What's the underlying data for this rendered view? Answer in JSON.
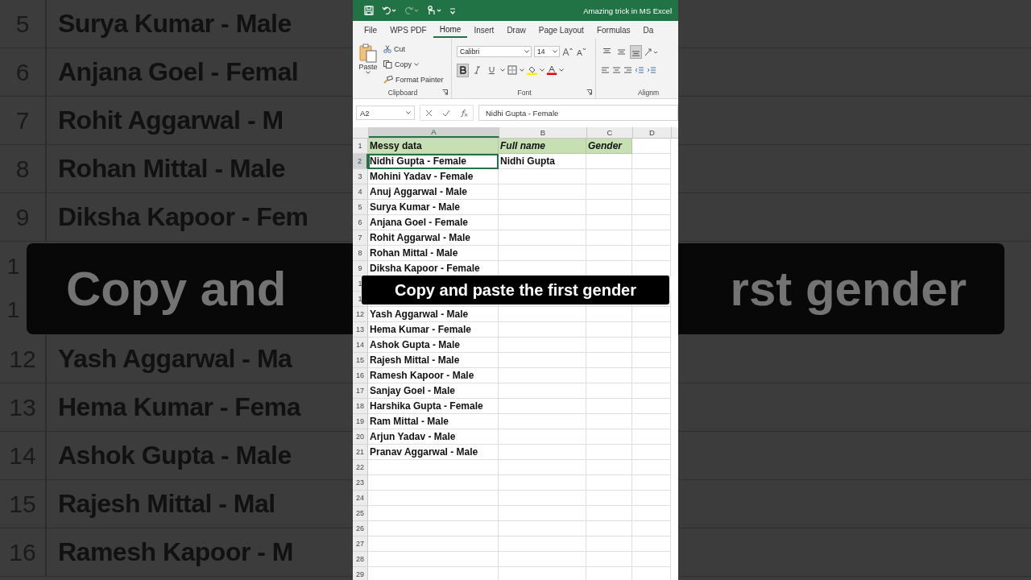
{
  "backdrop": {
    "rows_top": [
      {
        "number": "5",
        "text": "Surya Kumar - Male"
      },
      {
        "number": "6",
        "text": "Anjana Goel - Femal"
      },
      {
        "number": "7",
        "text": "Rohit Aggarwal - M"
      },
      {
        "number": "8",
        "text": "Rohan Mittal - Male"
      },
      {
        "number": "9",
        "text": "Diksha Kapoor - Fem"
      }
    ],
    "numbers_beside_caption": [
      "1",
      "1"
    ],
    "caption_left": "Copy and",
    "caption_right": "rst gender",
    "rows_bottom": [
      {
        "number": "12",
        "text": "Yash Aggarwal - Ma"
      },
      {
        "number": "13",
        "text": "Hema Kumar - Fema"
      },
      {
        "number": "14",
        "text": "Ashok Gupta - Male"
      },
      {
        "number": "15",
        "text": "Rajesh Mittal - Mal"
      },
      {
        "number": "16",
        "text": "Ramesh Kapoor - M"
      }
    ]
  },
  "window": {
    "title": "Amazing trick in MS Excel"
  },
  "tabs": [
    {
      "label": "File",
      "selected": false
    },
    {
      "label": "WPS PDF",
      "selected": false
    },
    {
      "label": "Home",
      "selected": true
    },
    {
      "label": "Insert",
      "selected": false
    },
    {
      "label": "Draw",
      "selected": false
    },
    {
      "label": "Page Layout",
      "selected": false
    },
    {
      "label": "Formulas",
      "selected": false
    },
    {
      "label": "Da",
      "selected": false
    }
  ],
  "clipboard": {
    "paste": "Paste",
    "cut": "Cut",
    "copy": "Copy",
    "format_painter": "Format Painter",
    "label": "Clipboard"
  },
  "font": {
    "name": "Calibri",
    "size": "14",
    "bold": true,
    "italic": false,
    "underline": false,
    "label": "Font"
  },
  "alignment": {
    "label": "Alignm",
    "vertical": [
      {
        "kind": "top",
        "selected": false
      },
      {
        "kind": "middle",
        "selected": false
      },
      {
        "kind": "bottom",
        "selected": true
      }
    ]
  },
  "formula_bar": {
    "name_box": "A2",
    "value": "Nidhi Gupta - Female"
  },
  "columns": [
    {
      "label": "A",
      "selected": true
    },
    {
      "label": "B",
      "selected": false
    },
    {
      "label": "C",
      "selected": false
    },
    {
      "label": "D",
      "selected": false
    }
  ],
  "rows": [
    {
      "kind": "data",
      "number": "1",
      "selected": false,
      "cells": [
        {
          "text": "Messy data",
          "highlighted": true,
          "italic": false
        },
        {
          "text": "Full name",
          "highlighted": true,
          "italic": true
        },
        {
          "text": "Gender",
          "highlighted": true,
          "italic": true
        }
      ]
    },
    {
      "kind": "data",
      "number": "2",
      "selected": true,
      "cells": [
        {
          "text": "Nidhi Gupta - Female",
          "selected": true
        },
        {
          "text": "Nidhi Gupta"
        }
      ]
    },
    {
      "kind": "data",
      "number": "3",
      "selected": false,
      "cells": [
        {
          "text": "Mohini Yadav - Female"
        }
      ]
    },
    {
      "kind": "data",
      "number": "4",
      "selected": false,
      "cells": [
        {
          "text": "Anuj Aggarwal - Male"
        }
      ]
    },
    {
      "kind": "data",
      "number": "5",
      "selected": false,
      "cells": [
        {
          "text": "Surya Kumar - Male"
        }
      ]
    },
    {
      "kind": "data",
      "number": "6",
      "selected": false,
      "cells": [
        {
          "text": "Anjana Goel - Female"
        }
      ]
    },
    {
      "kind": "data",
      "number": "7",
      "selected": false,
      "cells": [
        {
          "text": "Rohit Aggarwal - Male"
        }
      ]
    },
    {
      "kind": "data",
      "number": "8",
      "selected": false,
      "cells": [
        {
          "text": "Rohan Mittal - Male"
        }
      ]
    },
    {
      "kind": "data",
      "number": "9",
      "selected": false,
      "cells": [
        {
          "text": "Diksha Kapoor - Female"
        }
      ]
    },
    {
      "kind": "covered",
      "number": "1",
      "selected": false,
      "cells": []
    },
    {
      "kind": "data",
      "number": "1",
      "selected": false,
      "cells": []
    },
    {
      "kind": "data",
      "number": "12",
      "selected": false,
      "cells": [
        {
          "text": "Yash Aggarwal - Male"
        }
      ]
    },
    {
      "kind": "data",
      "number": "13",
      "selected": false,
      "cells": [
        {
          "text": "Hema Kumar - Female"
        }
      ]
    },
    {
      "kind": "data",
      "number": "14",
      "selected": false,
      "cells": [
        {
          "text": "Ashok Gupta - Male"
        }
      ]
    },
    {
      "kind": "data",
      "number": "15",
      "selected": false,
      "cells": [
        {
          "text": "Rajesh Mittal - Male"
        }
      ]
    },
    {
      "kind": "data",
      "number": "16",
      "selected": false,
      "cells": [
        {
          "text": "Ramesh Kapoor - Male"
        }
      ]
    },
    {
      "kind": "data",
      "number": "17",
      "selected": false,
      "cells": [
        {
          "text": "Sanjay Goel - Male"
        }
      ]
    },
    {
      "kind": "data",
      "number": "18",
      "selected": false,
      "cells": [
        {
          "text": "Harshika Gupta - Female"
        }
      ]
    },
    {
      "kind": "data",
      "number": "19",
      "selected": false,
      "cells": [
        {
          "text": "Ram Mittal - Male"
        }
      ]
    },
    {
      "kind": "data",
      "number": "20",
      "selected": false,
      "cells": [
        {
          "text": "Arjun Yadav - Male"
        }
      ]
    },
    {
      "kind": "data",
      "number": "21",
      "selected": false,
      "cells": [
        {
          "text": "Pranav Aggarwal - Male"
        }
      ]
    },
    {
      "kind": "data",
      "number": "22",
      "selected": false,
      "cells": []
    },
    {
      "kind": "data",
      "number": "23",
      "selected": false,
      "cells": []
    },
    {
      "kind": "data",
      "number": "24",
      "selected": false,
      "cells": []
    },
    {
      "kind": "data",
      "number": "25",
      "selected": false,
      "cells": []
    },
    {
      "kind": "data",
      "number": "26",
      "selected": false,
      "cells": []
    },
    {
      "kind": "data",
      "number": "27",
      "selected": false,
      "cells": []
    },
    {
      "kind": "data",
      "number": "28",
      "selected": false,
      "cells": []
    },
    {
      "kind": "data",
      "number": "29",
      "selected": false,
      "cells": []
    }
  ],
  "caption": "Copy and paste the first gender"
}
